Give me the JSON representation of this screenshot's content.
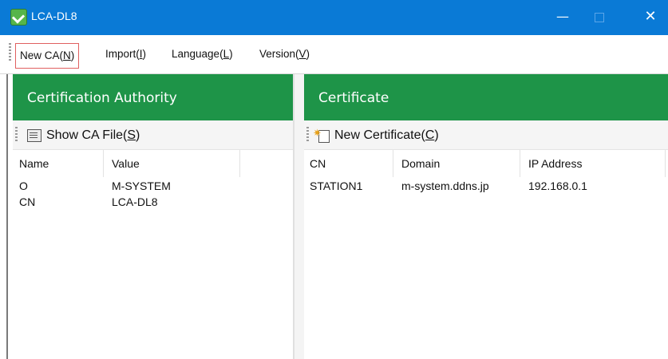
{
  "window": {
    "title": "LCA-DL8",
    "minimize": "—",
    "close": "✕"
  },
  "menu": [
    {
      "label": "New CA(",
      "key": "N",
      "end": ")"
    },
    {
      "label": "Import(",
      "key": "I",
      "end": ")"
    },
    {
      "label": "Language(",
      "key": "L",
      "end": ")"
    },
    {
      "label": "Version(",
      "key": "V",
      "end": ")"
    }
  ],
  "ca_panel": {
    "title": "Certification Authority",
    "toolbar": {
      "label": "Show CA File(",
      "key": "S",
      "end": ")",
      "icon": "file-list-icon"
    },
    "columns": [
      "Name",
      "Value"
    ],
    "rows": [
      {
        "name": "O",
        "value": "M-SYSTEM"
      },
      {
        "name": "CN",
        "value": "LCA-DL8"
      }
    ]
  },
  "cert_panel": {
    "title": "Certificate",
    "toolbar": {
      "label": "New Certificate(",
      "key": "C",
      "end": ")",
      "icon": "new-document-icon"
    },
    "columns": [
      "CN",
      "Domain",
      "IP Address"
    ],
    "rows": [
      {
        "cn": "STATION1",
        "domain": "m-system.ddns.jp",
        "ip": "192.168.0.1"
      }
    ]
  },
  "colors": {
    "titlebar": "#0a7ad6",
    "panel_header": "#1e9448"
  }
}
